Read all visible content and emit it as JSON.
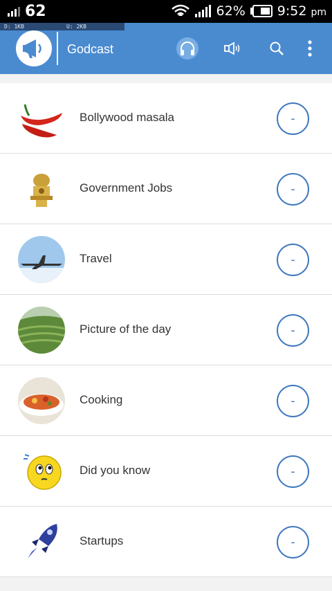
{
  "status_bar": {
    "signal_count": "62",
    "battery_percent": "62%",
    "time": "9:52",
    "ampm": "pm",
    "download": "D: 1KB",
    "upload": "U: 2KB"
  },
  "app_bar": {
    "title": "Godcast",
    "icons": [
      "megaphone-logo-icon",
      "headphones-icon",
      "speaker-icon",
      "search-icon",
      "more-vert-icon"
    ]
  },
  "categories": [
    {
      "label": "Bollywood masala",
      "thumb": "chili-icon",
      "action": "-"
    },
    {
      "label": "Government Jobs",
      "thumb": "emblem-icon",
      "action": "-"
    },
    {
      "label": "Travel",
      "thumb": "airplane-icon",
      "action": "-"
    },
    {
      "label": "Picture of the day",
      "thumb": "landscape-icon",
      "action": "-"
    },
    {
      "label": "Cooking",
      "thumb": "food-icon",
      "action": "-"
    },
    {
      "label": "Did you know",
      "thumb": "thinking-smiley-icon",
      "action": "-"
    },
    {
      "label": "Startups",
      "thumb": "rocket-icon",
      "action": "-"
    }
  ],
  "colors": {
    "primary": "#4a8bd0",
    "accent": "#3f78bd"
  }
}
